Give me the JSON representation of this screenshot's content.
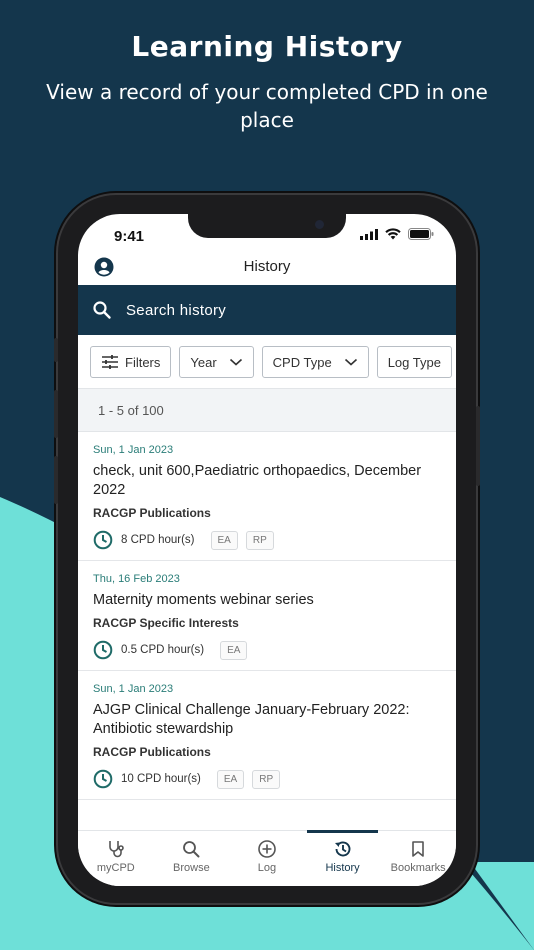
{
  "promo": {
    "title": "Learning History",
    "subtitle": "View a record of your completed CPD in one place"
  },
  "status_bar": {
    "time": "9:41",
    "icons": [
      "cellular-icon",
      "wifi-icon",
      "battery-icon"
    ]
  },
  "header": {
    "title": "History",
    "avatar_icon": "user-avatar-icon"
  },
  "search": {
    "placeholder": "Search history"
  },
  "filters": {
    "filters_label": "Filters",
    "year_label": "Year",
    "cpd_type_label": "CPD Type",
    "log_type_label": "Log Type"
  },
  "results": {
    "count_text": "1 - 5 of 100"
  },
  "items": [
    {
      "date": "Sun, 1 Jan 2023",
      "title": "check, unit 600,Paediatric orthopaedics, December 2022",
      "provider": "RACGP Publications",
      "hours": "8 CPD hour(s)",
      "tags": [
        "EA",
        "RP"
      ]
    },
    {
      "date": "Thu, 16 Feb 2023",
      "title": "Maternity moments webinar series",
      "provider": "RACGP Specific Interests",
      "hours": "0.5 CPD hour(s)",
      "tags": [
        "EA"
      ]
    },
    {
      "date": "Sun, 1 Jan 2023",
      "title": "AJGP Clinical Challenge January-February 2022: Antibiotic stewardship",
      "provider": "RACGP Publications",
      "hours": "10 CPD hour(s)",
      "tags": [
        "EA",
        "RP"
      ]
    }
  ],
  "tabs": [
    {
      "label": "myCPD",
      "icon": "stethoscope-icon",
      "active": false
    },
    {
      "label": "Browse",
      "icon": "search-icon",
      "active": false
    },
    {
      "label": "Log",
      "icon": "plus-circle-icon",
      "active": false
    },
    {
      "label": "History",
      "icon": "history-icon",
      "active": true
    },
    {
      "label": "Bookmarks",
      "icon": "bookmark-icon",
      "active": false
    }
  ],
  "colors": {
    "navy": "#14364c",
    "teal": "#6ee0d8",
    "accent_text": "#2a7d78"
  }
}
